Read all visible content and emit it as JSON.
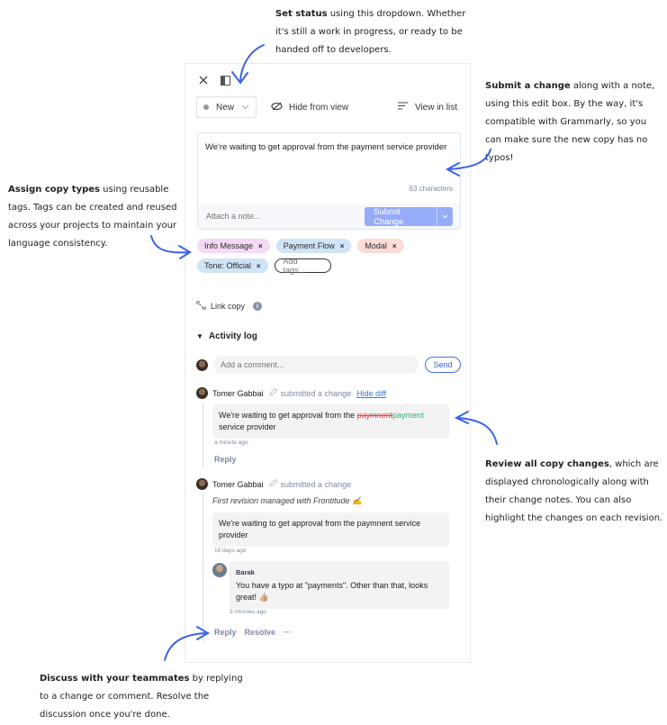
{
  "annotations": {
    "status": {
      "bold": "Set status",
      "text": " using this dropdown. Whether it's still a work in progress, or ready to be handed off to developers."
    },
    "submit": {
      "bold": "Submit a change",
      "text": " along with a note, using this edit box. By the way, it's compatible with Grammarly, so you can make sure the new copy has no typos!"
    },
    "tags": {
      "bold": "Assign copy types",
      "text": " using reusable tags. Tags can be created and reused across your projects to maintain your language consistency."
    },
    "review": {
      "bold": "Review all copy changes",
      "text": ", which are displayed chronologically along with their change notes. You can also highlight the changes on each revision."
    },
    "discuss": {
      "bold": "Discuss with your teammates",
      "text": " by replying to a change or comment. Resolve the discussion once you're done."
    }
  },
  "panel": {
    "toolbar": {
      "status_value": "New",
      "hide_label": "Hide from view",
      "list_label": "View in list"
    },
    "editor": {
      "text": "We're waiting to get approval from the payment service provider",
      "char_count": "63 characters",
      "note_placeholder": "Attach a note...",
      "submit_label": "Submit Change"
    },
    "tags": [
      {
        "label": "Info Message",
        "color": "#f6d9f4"
      },
      {
        "label": "Payment Flow",
        "color": "#cfe4f7"
      },
      {
        "label": "Modal",
        "color": "#fbdcd6"
      },
      {
        "label": "Tone: Official",
        "color": "#cfe4f7"
      }
    ],
    "add_tags_label": "Add tags...",
    "link_copy_label": "Link copy",
    "activity": {
      "title": "Activity log",
      "comment_placeholder": "Add a comment...",
      "send_label": "Send",
      "entries": [
        {
          "author": "Tomer Gabbai",
          "action": "submitted a change",
          "diff_link": "Hide diff",
          "text_before": "We're waiting to get approval from the ",
          "deleted": "paymnent",
          "inserted": "payment",
          "text_after": " service provider",
          "time": "a minute ago",
          "reply_label": "Reply"
        },
        {
          "author": "Tomer Gabbai",
          "action": "submitted a change",
          "note": "First revision managed with Frontitude ✍️",
          "text": "We're waiting to get approval from the paymnent service provider",
          "time": "16 days ago",
          "comment": {
            "author": "Barak",
            "text": "You have a typo at \"payments\". Other than that, looks great! 👍🏼",
            "time": "3 minutes ago"
          },
          "reply_label": "Reply",
          "resolve_label": "Resolve",
          "more_label": "···"
        }
      ]
    }
  },
  "colors": {
    "accent": "#3a62d8",
    "submit": "#96acf7",
    "arrow": "#3b63e6",
    "deleted": "#e5453a",
    "inserted": "#2bb36a"
  }
}
